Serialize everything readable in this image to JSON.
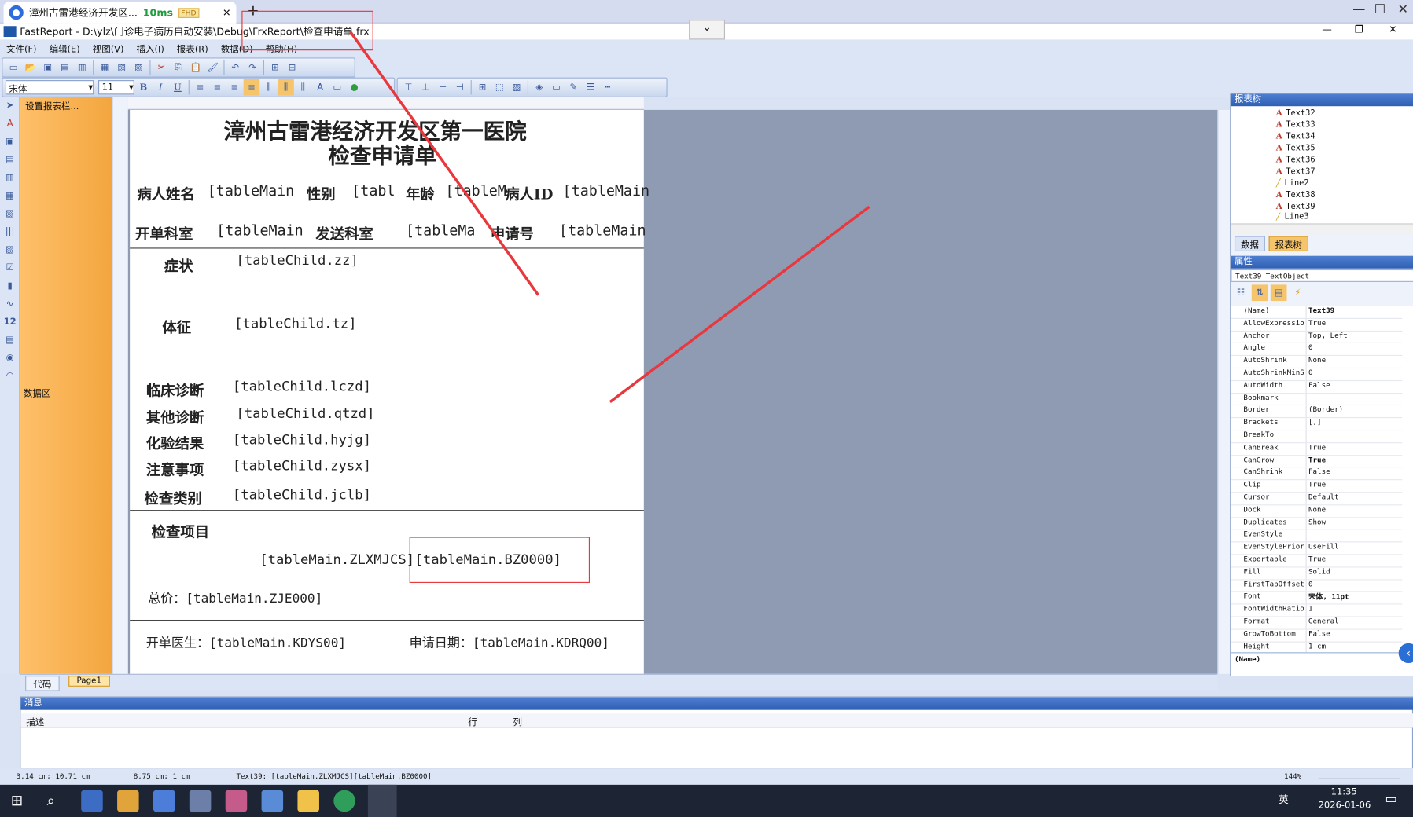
{
  "browser_tab": {
    "title": "漳州古雷港经济开发区...",
    "ping": "10ms",
    "hd": "FHD",
    "new_tab": "+"
  },
  "window": {
    "title": "FastReport - D:\\ylz\\门诊电子病历自动安装\\Debug\\FrxReport\\检查申请单.frx"
  },
  "menu": [
    "文件(F)",
    "编辑(E)",
    "视图(V)",
    "插入(I)",
    "报表(R)",
    "数据(D)",
    "帮助(H)"
  ],
  "font": {
    "family": "宋体",
    "size": "11"
  },
  "bands": {
    "header": "设置报表栏...",
    "data": "数据区"
  },
  "report": {
    "title1": "漳州古雷港经济开发区第一医院",
    "title2": "检查申请单",
    "row1": [
      "病人姓名",
      "[tableMain",
      "性别",
      "[tabl",
      "年龄",
      "[tableM",
      "病人ID",
      "[tableMain"
    ],
    "row2": [
      "开单科室",
      "[tableMain",
      "发送科室",
      "[tableMa",
      "申请号",
      "[tableMain"
    ],
    "fields": [
      {
        "label": "症状",
        "value": "[tableChild.zz]"
      },
      {
        "label": "体征",
        "value": "[tableChild.tz]"
      },
      {
        "label": "临床诊断",
        "value": "[tableChild.lczd]"
      },
      {
        "label": "其他诊断",
        "value": "[tableChild.qtzd]"
      },
      {
        "label": "化验结果",
        "value": "[tableChild.hyjg]"
      },
      {
        "label": "注意事项",
        "value": "[tableChild.zysx]"
      },
      {
        "label": "检查类别",
        "value": "[tableChild.jclb]"
      }
    ],
    "items_label": "检查项目",
    "item_a": "[tableMain.ZLXMJCS]",
    "item_b": "[tableMain.BZ0000]",
    "total": "总价：[tableMain.ZJE000]",
    "doctor": "开单医生：[tableMain.KDYS00]",
    "date": "申请日期：[tableMain.KDRQ00]"
  },
  "report_tree": {
    "header": "报表树",
    "items": [
      "Text32",
      "Text33",
      "Text34",
      "Text35",
      "Text36",
      "Text37",
      "Line2",
      "Text38",
      "Text39",
      "Line3"
    ],
    "tabs": [
      "数据",
      "报表树"
    ]
  },
  "properties": {
    "header": "属性",
    "object": "Text39 TextObject",
    "rows": [
      [
        "(Name)",
        "Text39"
      ],
      [
        "AllowExpressio",
        "True"
      ],
      [
        "Anchor",
        "Top, Left"
      ],
      [
        "Angle",
        "0"
      ],
      [
        "AutoShrink",
        "None"
      ],
      [
        "AutoShrinkMinS",
        "0"
      ],
      [
        "AutoWidth",
        "False"
      ],
      [
        "Bookmark",
        ""
      ],
      [
        "Border",
        "(Border)"
      ],
      [
        "Brackets",
        "[,]"
      ],
      [
        "BreakTo",
        ""
      ],
      [
        "CanBreak",
        "True"
      ],
      [
        "CanGrow",
        "True"
      ],
      [
        "CanShrink",
        "False"
      ],
      [
        "Clip",
        "True"
      ],
      [
        "Cursor",
        "Default"
      ],
      [
        "Dock",
        "None"
      ],
      [
        "Duplicates",
        "Show"
      ],
      [
        "EvenStyle",
        ""
      ],
      [
        "EvenStylePrior",
        "UseFill"
      ],
      [
        "Exportable",
        "True"
      ],
      [
        "Fill",
        "Solid"
      ],
      [
        "FirstTabOffset",
        "0"
      ],
      [
        "Font",
        "宋体, 11pt"
      ],
      [
        "FontWidthRatio",
        "1"
      ],
      [
        "Format",
        "General"
      ],
      [
        "GrowToBottom",
        "False"
      ],
      [
        "Height",
        "1 cm"
      ]
    ],
    "footer": "(Name)"
  },
  "bottom_tabs": [
    "代码",
    "Page1"
  ],
  "messages": {
    "header": "消息",
    "cols": [
      "描述",
      "行",
      "列"
    ]
  },
  "status": {
    "pos": "3.14 cm; 10.71 cm",
    "size": "8.75 cm; 1 cm",
    "info": "Text39:  [tableMain.ZLXMJCS][tableMain.BZ0000]",
    "zoom": "144%"
  },
  "clock": {
    "time": "11:35",
    "date": "2026-01-06",
    "ime": "英"
  }
}
